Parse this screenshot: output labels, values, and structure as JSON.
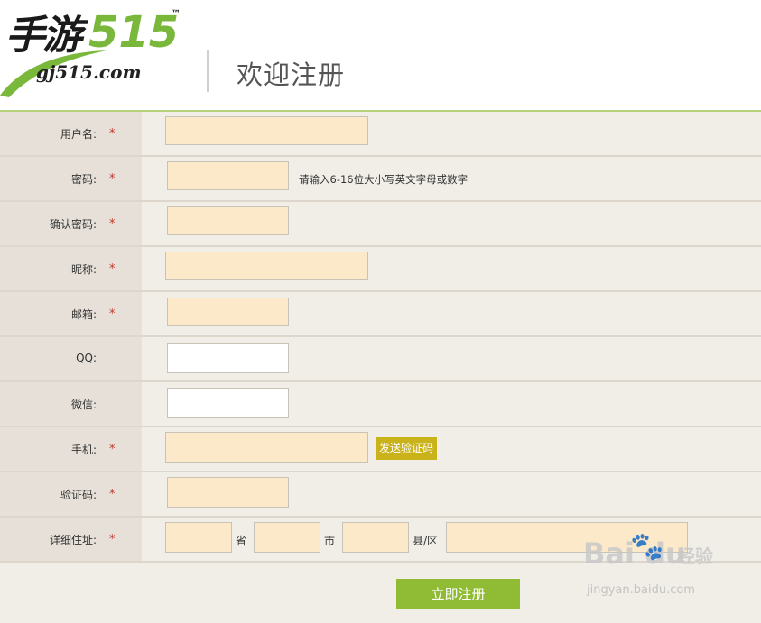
{
  "header": {
    "logo_main": "手游",
    "logo_number": "515",
    "logo_tm": "™",
    "logo_url": "gj515.com",
    "page_title": "欢迎注册"
  },
  "form": {
    "required_mark": "*",
    "username_label": "用户名:",
    "password_label": "密码:",
    "password_hint": "请输入6-16位大小写英文字母或数字",
    "confirm_password_label": "确认密码:",
    "nickname_label": "昵称:",
    "email_label": "邮箱:",
    "qq_label": "QQ:",
    "wechat_label": "微信:",
    "phone_label": "手机:",
    "send_code_button": "发送验证码",
    "code_label": "验证码:",
    "address_label": "详细住址:",
    "province_unit": "省",
    "city_unit": "市",
    "district_unit": "县/区"
  },
  "submit_button": "立即注册",
  "watermark": {
    "brand": "Bai  du",
    "product": "经验",
    "url": "jingyan.baidu.com"
  },
  "colors": {
    "accent_green": "#8fbb35",
    "send_button": "#c9b21a",
    "required": "#c0392b",
    "input_fill": "#fbe9c9"
  }
}
